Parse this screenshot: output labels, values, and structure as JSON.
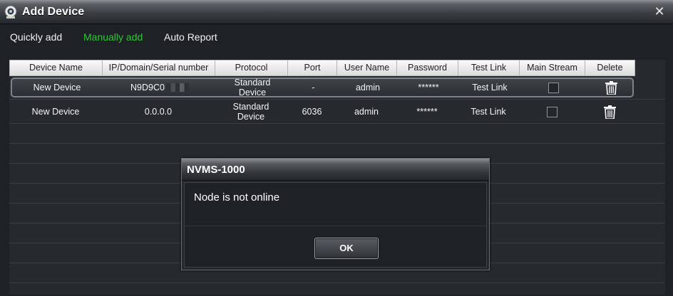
{
  "window": {
    "title": "Add Device",
    "close_glyph": "✕"
  },
  "tabs": [
    {
      "label": "Quickly add",
      "active": false
    },
    {
      "label": "Manually add",
      "active": true
    },
    {
      "label": "Auto Report",
      "active": false
    }
  ],
  "table": {
    "columns": [
      "Device Name",
      "IP/Domain/Serial number",
      "Protocol",
      "Port",
      "User Name",
      "Password",
      "Test Link",
      "Main Stream",
      "Delete"
    ],
    "rows": [
      {
        "device_name": "New Device",
        "address": "N9D9C0",
        "protocol_line1": "Standard",
        "protocol_line2": "Device",
        "port": "-",
        "user_name": "admin",
        "password": "******",
        "test_link": "Test Link",
        "main_stream": false,
        "delete_icon": "trash-icon",
        "selected": true
      },
      {
        "device_name": "New Device",
        "address": "0.0.0.0",
        "protocol_line1": "Standard",
        "protocol_line2": "Device",
        "port": "6036",
        "user_name": "admin",
        "password": "******",
        "test_link": "Test Link",
        "main_stream": false,
        "delete_icon": "trash-icon",
        "selected": false
      }
    ]
  },
  "dialog": {
    "title": "NVMS-1000",
    "message": "Node is not online",
    "ok_label": "OK"
  },
  "colors": {
    "active_tab": "#35c43a",
    "background": "#1e2125"
  }
}
